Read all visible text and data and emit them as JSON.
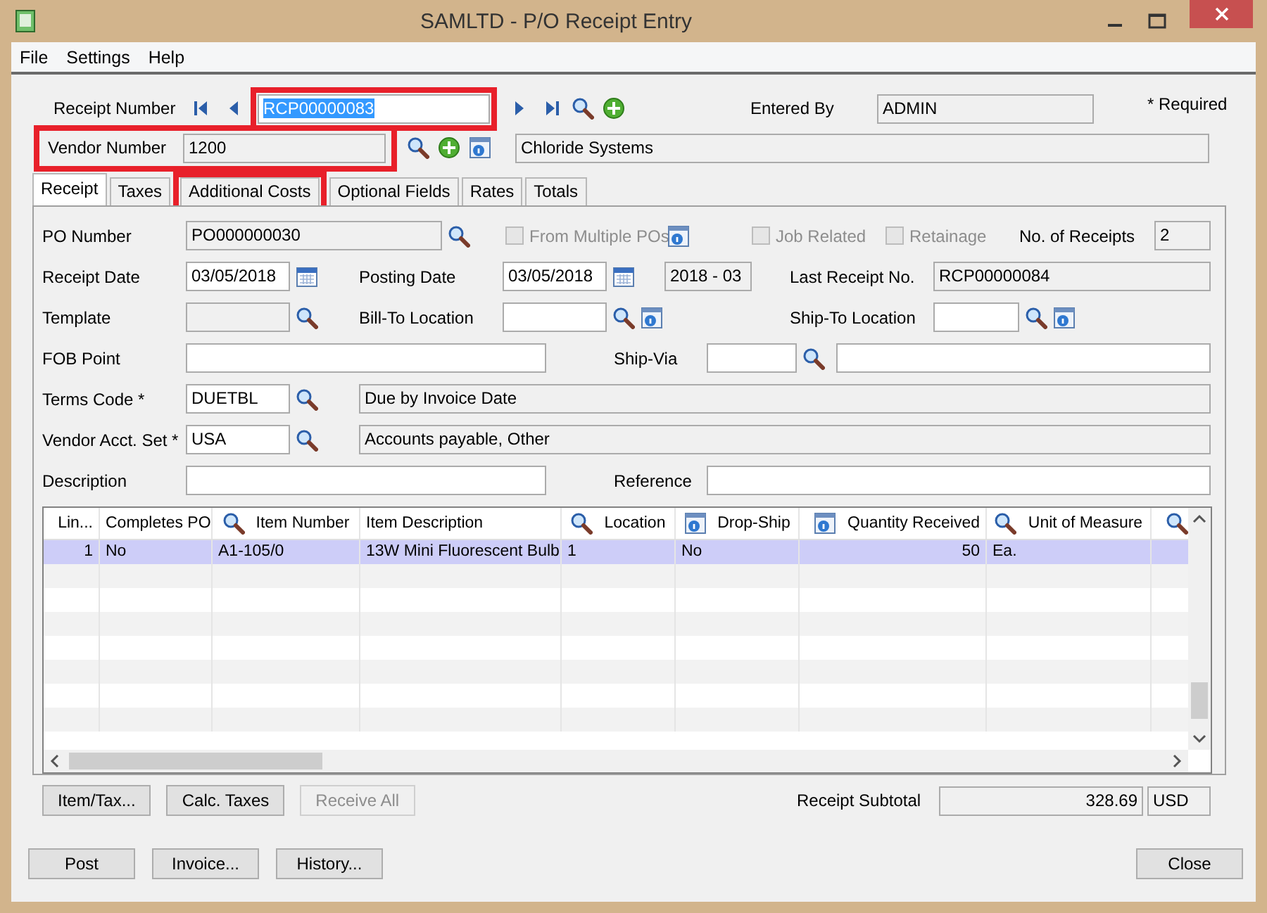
{
  "window": {
    "title": "SAMLTD - P/O Receipt Entry"
  },
  "menu": [
    {
      "label": "File"
    },
    {
      "label": "Settings"
    },
    {
      "label": "Help"
    }
  ],
  "header": {
    "receipt_number": {
      "label": "Receipt Number",
      "value": "RCP00000083",
      "highlighted": true
    },
    "entered_by": {
      "label": "Entered By",
      "value": "ADMIN"
    },
    "required_note": "*  Required",
    "vendor_number": {
      "label": "Vendor Number",
      "value": "1200",
      "highlighted": true
    },
    "vendor_name": "Chloride Systems"
  },
  "tabs": [
    {
      "label": "Receipt",
      "selected": true,
      "highlighted": false
    },
    {
      "label": "Taxes",
      "selected": false,
      "highlighted": false
    },
    {
      "label": "Additional Costs",
      "selected": false,
      "highlighted": true
    },
    {
      "label": "Optional Fields",
      "selected": false,
      "highlighted": false
    },
    {
      "label": "Rates",
      "selected": false,
      "highlighted": false
    },
    {
      "label": "Totals",
      "selected": false,
      "highlighted": false
    }
  ],
  "form": {
    "po_number": {
      "label": "PO Number",
      "value": "PO000000030",
      "editable": false
    },
    "from_multiple_pos": {
      "label": "From Multiple POs",
      "checked": false,
      "disabled": true
    },
    "job_related": {
      "label": "Job Related",
      "checked": false,
      "disabled": true
    },
    "retainage": {
      "label": "Retainage",
      "checked": false,
      "disabled": true
    },
    "no_of_receipts": {
      "label": "No. of Receipts",
      "value": "2",
      "editable": false
    },
    "receipt_date": {
      "label": "Receipt Date",
      "value": "03/05/2018",
      "editable": true
    },
    "posting_date": {
      "label": "Posting Date",
      "value": "03/05/2018",
      "editable": true
    },
    "fiscal_period": {
      "value": "2018 - 03",
      "editable": false
    },
    "last_receipt_no": {
      "label": "Last Receipt No.",
      "value": "RCP00000084",
      "editable": false
    },
    "template": {
      "label": "Template",
      "editable": false
    },
    "bill_to_location": {
      "label": "Bill-To Location",
      "editable": true
    },
    "ship_to_location": {
      "label": "Ship-To Location",
      "editable": true
    },
    "fob_point": {
      "label": "FOB Point",
      "editable": true
    },
    "ship_via": {
      "label": "Ship-Via",
      "editable": true
    },
    "terms_code": {
      "label": "Terms Code *",
      "value": "DUETBL",
      "editable": true,
      "description": "Due by Invoice Date"
    },
    "vendor_acct_set": {
      "label": "Vendor Acct. Set *",
      "value": "USA",
      "editable": true,
      "description": "Accounts payable, Other"
    },
    "description": {
      "label": "Description",
      "editable": true
    },
    "reference": {
      "label": "Reference",
      "editable": true
    }
  },
  "grid": {
    "columns": [
      {
        "label": "Lin..."
      },
      {
        "label": "Completes PO"
      },
      {
        "label": "Item Number"
      },
      {
        "label": "Item Description"
      },
      {
        "label": "Location"
      },
      {
        "label": "Drop-Ship"
      },
      {
        "label": "Quantity Received"
      },
      {
        "label": "Unit of Measure"
      },
      {}
    ],
    "rows": [
      {
        "selected": true,
        "cells": [
          "1",
          "No",
          "A1-105/0",
          "13W Mini Fluorescent Bulb",
          "1",
          "No",
          "50",
          "Ea.",
          null
        ]
      }
    ]
  },
  "actions": [
    {
      "label": "Item/Tax...",
      "disabled": false
    },
    {
      "label": "Calc. Taxes",
      "disabled": false
    },
    {
      "label": "Receive All",
      "disabled": true
    }
  ],
  "subtotal": {
    "label": "Receipt Subtotal",
    "value": "328.69",
    "currency": "USD"
  },
  "footer": {
    "buttons": [
      {
        "label": "Post"
      },
      {
        "label": "Invoice..."
      },
      {
        "label": "History..."
      }
    ],
    "close": "Close"
  }
}
